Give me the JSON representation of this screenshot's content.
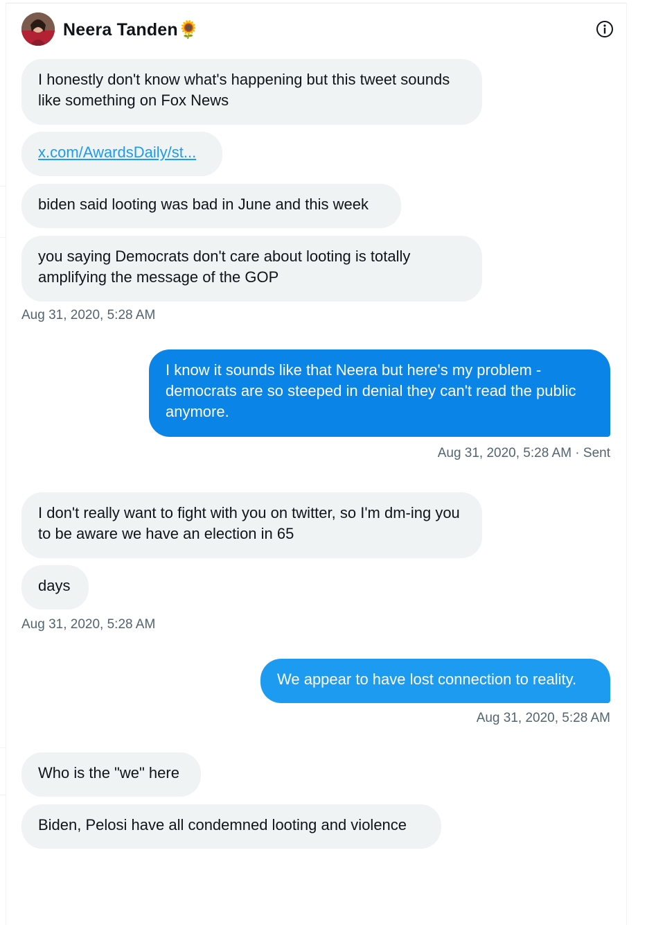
{
  "conversation": {
    "contact_name": "Neera Tanden",
    "contact_emoji": "🌻"
  },
  "messages": [
    {
      "from": "them",
      "text": "I honestly don't know what's happening but this tweet sounds like something on Fox News"
    },
    {
      "from": "them",
      "text": "x.com/AwardsDaily/st...",
      "is_link": true
    },
    {
      "from": "them",
      "text": "biden said looting was bad in June and this week"
    },
    {
      "from": "them",
      "text": "you saying Democrats don't care about looting is totally amplifying the message of the GOP"
    },
    {
      "from": "me",
      "text": "I know it sounds like that Neera but here's my problem - democrats are so steeped in denial they can't read the public anymore."
    },
    {
      "from": "them",
      "text": "I don't really want to fight with you on twitter, so I'm dm-ing you to be aware we have an election in 65"
    },
    {
      "from": "them",
      "text": "days"
    },
    {
      "from": "me",
      "text": "We appear to have lost connection to reality."
    },
    {
      "from": "them",
      "text": "Who is the \"we\" here"
    },
    {
      "from": "them",
      "text": "Biden, Pelosi have all condemned looting and violence"
    }
  ],
  "timestamps": [
    "Aug 31, 2020, 5:28 AM",
    "Aug 31, 2020, 5:28 AM · Sent",
    "Aug 31, 2020, 5:28 AM",
    "Aug 31, 2020, 5:28 AM"
  ],
  "icons": {
    "info": "info-circle-icon"
  },
  "colors": {
    "outgoing": "#1d9bf0",
    "incoming": "#eff3f4",
    "timestamp": "#536471"
  }
}
